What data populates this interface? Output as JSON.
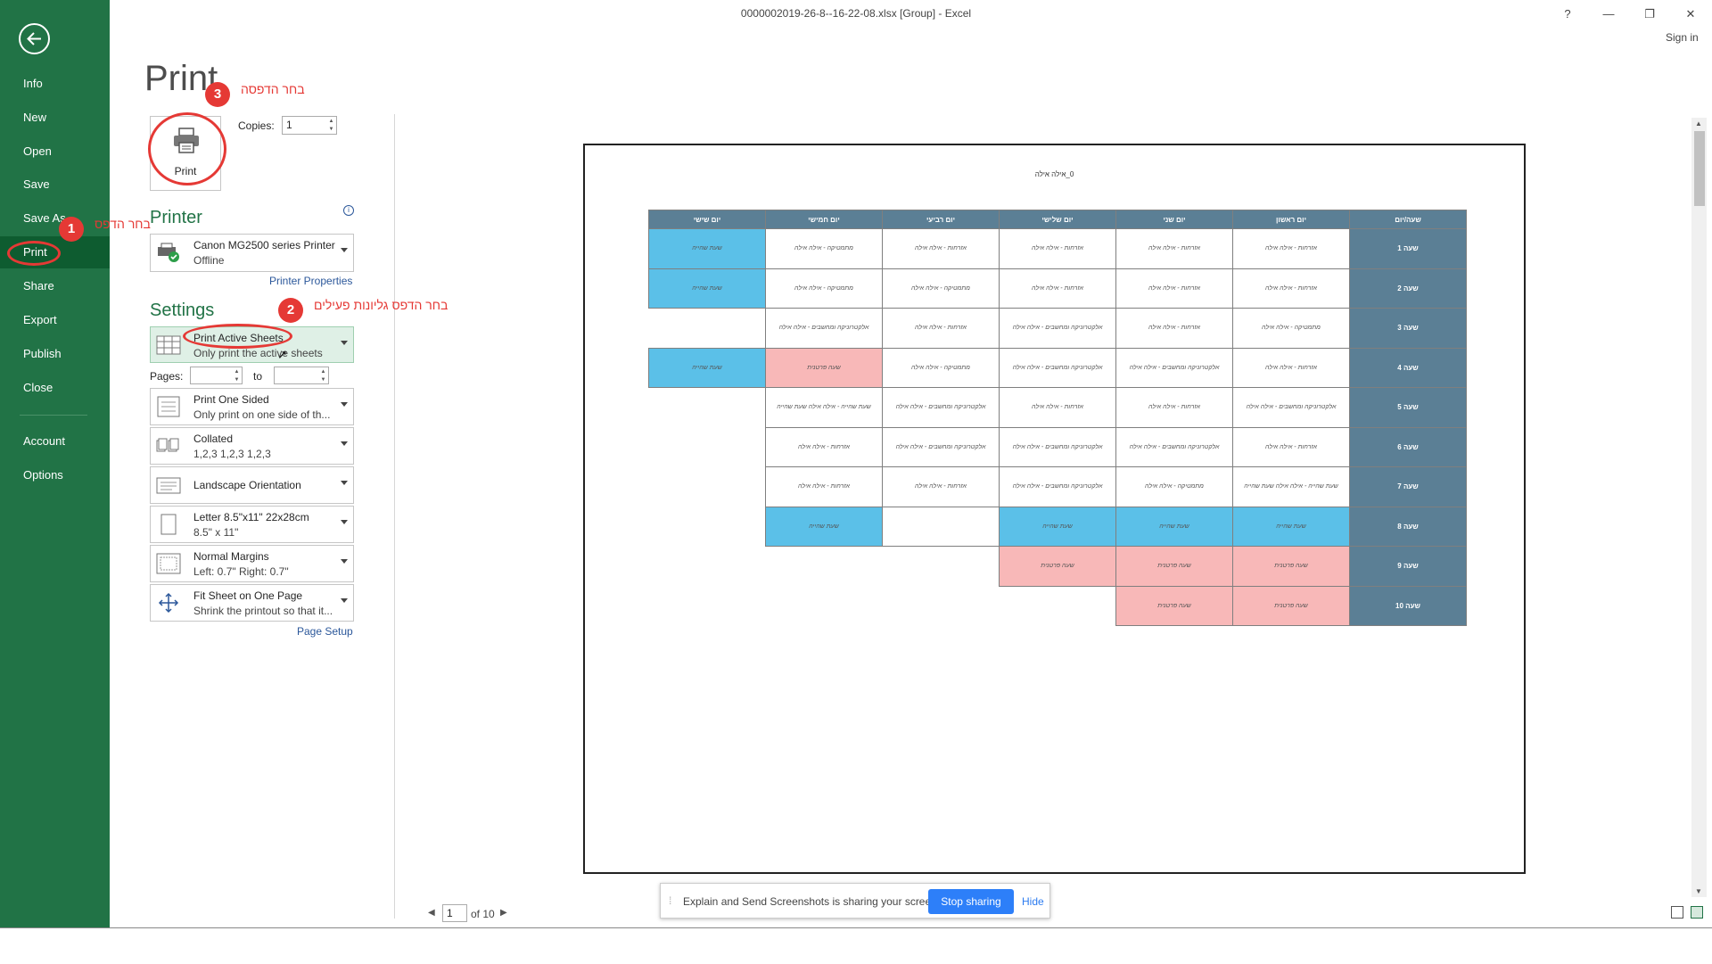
{
  "window": {
    "title": "0000002019-26-8--16-22-08.xlsx  [Group]  -  Excel",
    "help": "?",
    "minimize": "—",
    "restore": "❐",
    "close": "✕",
    "sign_in": "Sign in"
  },
  "sidebar": {
    "items": [
      {
        "label": "Info"
      },
      {
        "label": "New"
      },
      {
        "label": "Open"
      },
      {
        "label": "Save"
      },
      {
        "label": "Save As"
      },
      {
        "label": "Print"
      },
      {
        "label": "Share"
      },
      {
        "label": "Export"
      },
      {
        "label": "Publish"
      },
      {
        "label": "Close"
      },
      {
        "label": "Account"
      },
      {
        "label": "Options"
      }
    ],
    "active": "Print"
  },
  "print": {
    "heading": "Print",
    "button_label": "Print",
    "copies_label": "Copies:",
    "copies_value": "1"
  },
  "printer": {
    "heading": "Printer",
    "name": "Canon MG2500 series Printer",
    "status": "Offline",
    "properties_link": "Printer Properties"
  },
  "settings": {
    "heading": "Settings",
    "what": {
      "title": "Print Active Sheets",
      "subtitle": "Only print the active sheets"
    },
    "pages_label": "Pages:",
    "pages_from": "",
    "to_label": "to",
    "pages_to": "",
    "sides": {
      "title": "Print One Sided",
      "subtitle": "Only print on one side of th..."
    },
    "collation": {
      "title": "Collated",
      "subtitle": "1,2,3    1,2,3    1,2,3"
    },
    "orientation": {
      "title": "Landscape Orientation",
      "subtitle": ""
    },
    "paper": {
      "title": "Letter 8.5\"x11\" 22x28cm",
      "subtitle": "8.5\" x 11\""
    },
    "margins": {
      "title": "Normal Margins",
      "subtitle": "Left:  0.7\"    Right:  0.7\""
    },
    "scaling": {
      "title": "Fit Sheet on One Page",
      "subtitle": "Shrink the printout so that it..."
    },
    "page_setup_link": "Page Setup"
  },
  "preview": {
    "page_title": "0_אילה אילה",
    "headers": [
      "שעה/יום",
      "יום ראשון",
      "יום שני",
      "יום שלישי",
      "יום רביעי",
      "יום חמישי",
      "יום שישי"
    ],
    "rows": [
      {
        "hour": "שעה 1",
        "cells": [
          {
            "t": "אזרחות - אילה אילה"
          },
          {
            "t": "אזרחות - אילה אילה"
          },
          {
            "t": "אזרחות - אילה אילה"
          },
          {
            "t": "אזרחות - אילה אילה"
          },
          {
            "t": "מתמטיקה - אילה אילה"
          },
          {
            "t": "שעת שהייה",
            "c": "blue"
          }
        ]
      },
      {
        "hour": "שעה 2",
        "cells": [
          {
            "t": "אזרחות - אילה אילה"
          },
          {
            "t": "אזרחות - אילה אילה"
          },
          {
            "t": "אזרחות - אילה אילה"
          },
          {
            "t": "מתמטיקה - אילה אילה"
          },
          {
            "t": "מתמטיקה - אילה אילה"
          },
          {
            "t": "שעת שהייה",
            "c": "blue"
          }
        ]
      },
      {
        "hour": "שעה 3",
        "cells": [
          {
            "t": "מתמטיקה - אילה אילה"
          },
          {
            "t": "אזרחות - אילה אילה"
          },
          {
            "t": "אלקטרוניקה ומחשבים - אילה אילה"
          },
          {
            "t": "אזרחות - אילה אילה"
          },
          {
            "t": "אלקטרוניקה ומחשבים - אילה אילה"
          },
          {
            "t": "",
            "c": "empty"
          }
        ]
      },
      {
        "hour": "שעה 4",
        "cells": [
          {
            "t": "אזרחות - אילה אילה"
          },
          {
            "t": "אלקטרוניקה ומחשבים - אילה אילה"
          },
          {
            "t": "אלקטרוניקה ומחשבים - אילה אילה"
          },
          {
            "t": "מתמטיקה - אילה אילה"
          },
          {
            "t": "שעה פרטנית",
            "c": "pink"
          },
          {
            "t": "שעת שהייה",
            "c": "blue"
          }
        ]
      },
      {
        "hour": "שעה 5",
        "cells": [
          {
            "t": "אלקטרוניקה ומחשבים - אילה אילה"
          },
          {
            "t": "אזרחות - אילה אילה"
          },
          {
            "t": "אזרחות - אילה אילה"
          },
          {
            "t": "אלקטרוניקה ומחשבים - אילה אילה"
          },
          {
            "t": "שעת שהייה - אילה אילה שעת שהייה"
          },
          {
            "t": "",
            "c": "empty"
          }
        ]
      },
      {
        "hour": "שעה 6",
        "cells": [
          {
            "t": "אזרחות - אילה אילה"
          },
          {
            "t": "אלקטרוניקה ומחשבים - אילה אילה"
          },
          {
            "t": "אלקטרוניקה ומחשבים - אילה אילה"
          },
          {
            "t": "אלקטרוניקה ומחשבים - אילה אילה"
          },
          {
            "t": "אזרחות - אילה אילה"
          },
          {
            "t": "",
            "c": "empty"
          }
        ]
      },
      {
        "hour": "שעה 7",
        "cells": [
          {
            "t": "שעת שהייה - אילה אילה שעת שהייה"
          },
          {
            "t": "מתמטיקה - אילה אילה"
          },
          {
            "t": "אלקטרוניקה ומחשבים - אילה אילה"
          },
          {
            "t": "אזרחות - אילה אילה"
          },
          {
            "t": "אזרחות - אילה אילה"
          },
          {
            "t": "",
            "c": "empty"
          }
        ]
      },
      {
        "hour": "שעה 8",
        "cells": [
          {
            "t": "שעת שהייה",
            "c": "blue"
          },
          {
            "t": "שעת שהייה",
            "c": "blue"
          },
          {
            "t": "שעת שהייה",
            "c": "blue"
          },
          {
            "t": ""
          },
          {
            "t": "שעת שהייה",
            "c": "blue"
          },
          {
            "t": "",
            "c": "empty"
          }
        ]
      },
      {
        "hour": "שעה 9",
        "cells": [
          {
            "t": "שעה פרטנית",
            "c": "pink"
          },
          {
            "t": "שעה פרטנית",
            "c": "pink"
          },
          {
            "t": "שעה פרטנית",
            "c": "pink"
          },
          {
            "t": "",
            "c": "empty"
          },
          {
            "t": "",
            "c": "empty"
          },
          {
            "t": "",
            "c": "empty"
          }
        ]
      },
      {
        "hour": "שעה 10",
        "cells": [
          {
            "t": "שעה פרטנית",
            "c": "pink"
          },
          {
            "t": "שעה פרטנית",
            "c": "pink"
          },
          {
            "t": "",
            "c": "empty"
          },
          {
            "t": "",
            "c": "empty"
          },
          {
            "t": "",
            "c": "empty"
          },
          {
            "t": "",
            "c": "empty"
          }
        ]
      }
    ],
    "page_current": "1",
    "page_of": "of 10"
  },
  "sharing_bar": {
    "message": "Explain and Send Screenshots is sharing your screen.",
    "stop_label": "Stop sharing",
    "hide_label": "Hide"
  },
  "annotations": {
    "step1_number": "1",
    "step1_text": "בחר הדפס",
    "step2_number": "2",
    "step2_text": "בחר הדפס גליונות פעילים",
    "step3_number": "3",
    "step3_text": "בחר הדפסה"
  },
  "colors": {
    "sidebar_bg": "#217346",
    "accent": "#217346",
    "annotation": "#e53935",
    "header_cell": "#5b7f95",
    "blue_cell": "#5bc0e8",
    "pink_cell": "#f8b8b8",
    "share_button": "#2d7ff9"
  }
}
